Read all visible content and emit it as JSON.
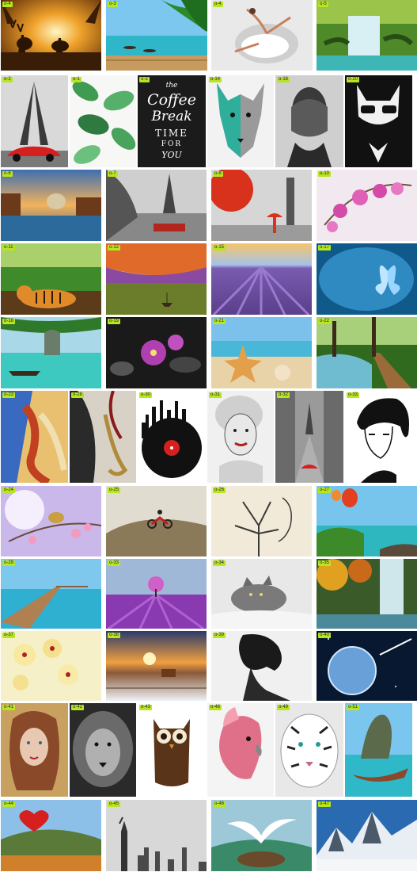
{
  "tiles": [
    {
      "label": "o-4",
      "subject": "deer at sunset"
    },
    {
      "label": "o-3",
      "subject": "palm beach boats"
    },
    {
      "label": "o-4",
      "subject": "ballerina"
    },
    {
      "label": "o-5",
      "subject": "waterfall"
    },
    {
      "label": "o-2",
      "subject": "eiffel tower red car"
    },
    {
      "label": "o-1",
      "subject": "tropical leaves"
    },
    {
      "label": "o-3",
      "subject": "coffee break chalkboard"
    },
    {
      "label": "o-14",
      "subject": "wolf"
    },
    {
      "label": "o-16",
      "subject": "hands over face"
    },
    {
      "label": "o-20",
      "subject": "bulldog in suit"
    },
    {
      "label": "o-6",
      "subject": "venice canal"
    },
    {
      "label": "o-7",
      "subject": "paris river"
    },
    {
      "label": "o-8",
      "subject": "london red umbrella"
    },
    {
      "label": "o-10",
      "subject": "pink orchid"
    },
    {
      "label": "o-11",
      "subject": "tiger in jungle"
    },
    {
      "label": "o-12",
      "subject": "boat painting"
    },
    {
      "label": "o-15",
      "subject": "lavender field"
    },
    {
      "label": "o-17",
      "subject": "blue butterfly"
    },
    {
      "label": "o-18",
      "subject": "tropical lagoon boat"
    },
    {
      "label": "o-19",
      "subject": "purple orchids on stones"
    },
    {
      "label": "o-21",
      "subject": "starfish and shells"
    },
    {
      "label": "o-22",
      "subject": "forest path"
    },
    {
      "label": "o-23",
      "subject": "violin player"
    },
    {
      "label": "o-28",
      "subject": "saxophone player"
    },
    {
      "label": "o-30",
      "subject": "vinyl record city"
    },
    {
      "label": "o-31",
      "subject": "marilyn portrait"
    },
    {
      "label": "o-32",
      "subject": "red umbrella street"
    },
    {
      "label": "o-33",
      "subject": "audrey silhouette"
    },
    {
      "label": "o-24",
      "subject": "bird on blossom"
    },
    {
      "label": "o-25",
      "subject": "motocross jump"
    },
    {
      "label": "o-26",
      "subject": "tree face"
    },
    {
      "label": "o-27",
      "subject": "balloons over coast"
    },
    {
      "label": "o-29",
      "subject": "wooden pier"
    },
    {
      "label": "o-33",
      "subject": "purple tree"
    },
    {
      "label": "o-34",
      "subject": "grey cat"
    },
    {
      "label": "o-35",
      "subject": "waterfall autumn"
    },
    {
      "label": "o-37",
      "subject": "yellow orchids"
    },
    {
      "label": "o-38",
      "subject": "winter sunset"
    },
    {
      "label": "o-39",
      "subject": "woman silhouette"
    },
    {
      "label": "o-40",
      "subject": "planet in space"
    },
    {
      "label": "o-41",
      "subject": "painted woman"
    },
    {
      "label": "o-42",
      "subject": "lion"
    },
    {
      "label": "o-43",
      "subject": "coffee owl"
    },
    {
      "label": "o-48",
      "subject": "pink cockatoo"
    },
    {
      "label": "o-49",
      "subject": "white tiger"
    },
    {
      "label": "o-51",
      "subject": "longtail boat"
    },
    {
      "label": "o-44",
      "subject": "heart balloon"
    },
    {
      "label": "o-45",
      "subject": "statue of liberty"
    },
    {
      "label": "o-46",
      "subject": "seagull"
    },
    {
      "label": "o-47",
      "subject": "mountains"
    }
  ],
  "coffee": {
    "line1": "Coffee",
    "line2": "Break",
    "line3": "TIME",
    "line4": "FOR",
    "line5": "YOU",
    "top": "the"
  }
}
